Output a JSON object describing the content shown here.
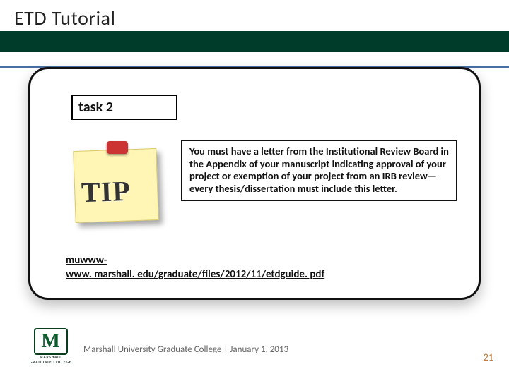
{
  "header": {
    "title": "ETD Tutorial"
  },
  "card": {
    "task_label": "task 2",
    "tip_graphic_text": "TIP",
    "tip_body": "You must have a letter from the Institutional Review Board in the Appendix of your manuscript indicating approval of your project or exemption of your project from an IRB review—every thesis/dissertation must include this letter.",
    "link_line1": "muwww-",
    "link_line2": "www. marshall. edu/graduate/files/2012/11/etdguide. pdf"
  },
  "footer": {
    "logo_letter": "M",
    "logo_caption_top": "MARSHALL",
    "logo_caption_bottom": "GRADUATE COLLEGE",
    "text": "Marshall University Graduate College | January 1, 2013",
    "page": "21"
  }
}
